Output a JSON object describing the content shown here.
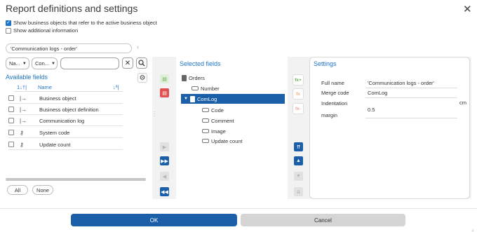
{
  "dialog": {
    "title": "Report definitions and settings",
    "close_glyph": "✕"
  },
  "options": {
    "show_refer": {
      "label": "Show business objects that refer to the active business object",
      "checked": true
    },
    "show_additional": {
      "label": "Show additional information",
      "checked": false
    }
  },
  "context": {
    "value": "'Communication logs - order'"
  },
  "filters": {
    "select1": "Na...",
    "select2": "Con...",
    "search_value": ""
  },
  "available": {
    "label": "Available fields",
    "head_sort": "1↓†|",
    "head_name": "Name",
    "head_sort2": "↓ª|",
    "items": [
      {
        "label": "Business object",
        "icon": "arrow-into-icon"
      },
      {
        "label": "Business object definition",
        "icon": "arrow-into-icon"
      },
      {
        "label": "Communication log",
        "icon": "arrow-into-icon"
      },
      {
        "label": "System code",
        "icon": "key-icon"
      },
      {
        "label": "Update count",
        "icon": "key-icon"
      }
    ],
    "all_label": "All",
    "none_label": "None"
  },
  "selected": {
    "label": "Selected fields",
    "tree": {
      "root": "Orders",
      "child1": "Number",
      "child2": "ComLog",
      "sub": [
        "Code",
        "Comment",
        "Image",
        "Update count"
      ]
    }
  },
  "settings": {
    "title": "Settings",
    "full_name_label": "Full name",
    "full_name_value": "'Communication logs - order'",
    "merge_code_label": "Merge code",
    "merge_code_value": "ComLog",
    "indent_label_1": "Indentation",
    "indent_label_2": "margin",
    "indent_value": "0.5",
    "indent_unit": "cm"
  },
  "footer": {
    "ok_label": "OK",
    "cancel_label": "Cancel"
  },
  "colors": {
    "accent": "#1a5fa8",
    "link": "#1e74c6"
  }
}
